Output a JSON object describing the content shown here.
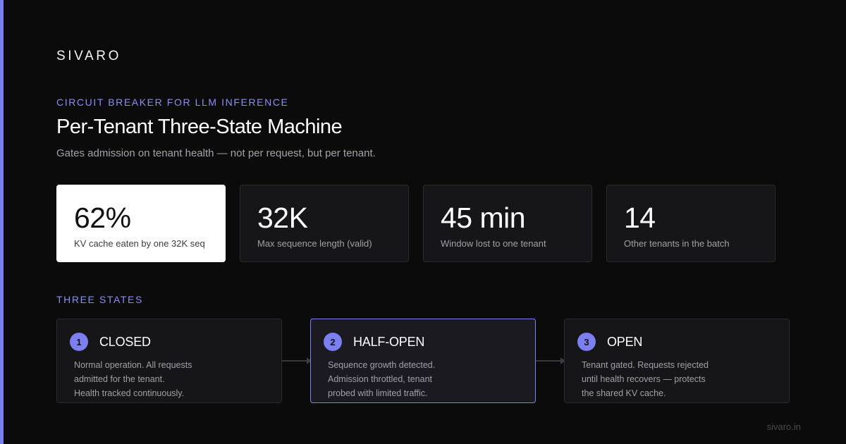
{
  "brand": "SIVARO",
  "eyebrow": "CIRCUIT BREAKER FOR LLM INFERENCE",
  "title": "Per-Tenant Three-State Machine",
  "subtitle": "Gates admission on tenant health — not per request, but per tenant.",
  "stats": [
    {
      "value": "62%",
      "label": "KV cache eaten by one 32K seq"
    },
    {
      "value": "32K",
      "label": "Max sequence length (valid)"
    },
    {
      "value": "45 min",
      "label": "Window lost to one tenant"
    },
    {
      "value": "14",
      "label": "Other tenants in the batch"
    }
  ],
  "section_label": "THREE STATES",
  "states": [
    {
      "number": "1",
      "name": "CLOSED",
      "lines": [
        "Normal operation. All requests",
        "admitted for the tenant.",
        "Health tracked continuously."
      ]
    },
    {
      "number": "2",
      "name": "HALF-OPEN",
      "lines": [
        "Sequence growth detected.",
        "Admission throttled, tenant",
        "probed with limited traffic."
      ]
    },
    {
      "number": "3",
      "name": "OPEN",
      "lines": [
        "Tenant gated. Requests rejected",
        "until health recovers — protects",
        "the shared KV cache."
      ]
    }
  ],
  "footer": "sivaro.in",
  "colors": {
    "accent": "#7b7ff0",
    "background": "#0b0b0c",
    "card": "#161618"
  }
}
